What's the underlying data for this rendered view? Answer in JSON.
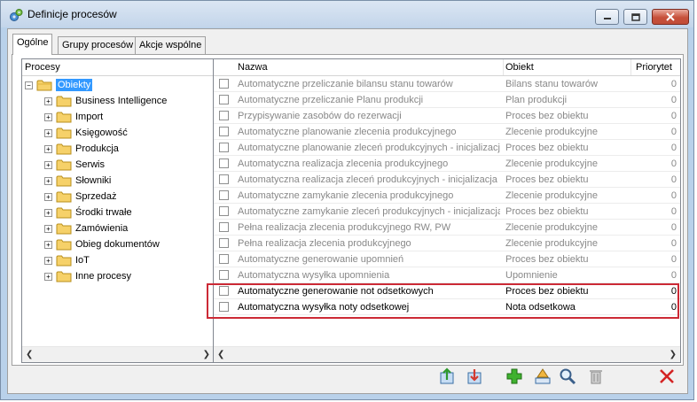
{
  "window": {
    "title": "Definicje procesów"
  },
  "tabs": [
    {
      "label": "Ogólne",
      "active": true
    },
    {
      "label": "Grupy procesów",
      "active": false
    },
    {
      "label": "Akcje wspólne",
      "active": false
    }
  ],
  "tree": {
    "header": "Procesy",
    "root": {
      "label": "Obiekty",
      "expander": "−"
    },
    "items": [
      {
        "label": "Business Intelligence",
        "expander": "+"
      },
      {
        "label": "Import",
        "expander": "+"
      },
      {
        "label": "Księgowość",
        "expander": "+"
      },
      {
        "label": "Produkcja",
        "expander": "+"
      },
      {
        "label": "Serwis",
        "expander": "+"
      },
      {
        "label": "Słowniki",
        "expander": "+"
      },
      {
        "label": "Sprzedaż",
        "expander": "+"
      },
      {
        "label": "Środki trwałe",
        "expander": "+"
      },
      {
        "label": "Zamówienia",
        "expander": "+"
      },
      {
        "label": "Obieg dokumentów",
        "expander": "+"
      },
      {
        "label": "IoT",
        "expander": "+"
      },
      {
        "label": "Inne procesy",
        "expander": "+"
      }
    ]
  },
  "grid": {
    "columns": {
      "name": "Nazwa",
      "object": "Obiekt",
      "priority": "Priorytet"
    },
    "rows": [
      {
        "name": "Automatyczne przeliczanie bilansu stanu towarów",
        "object": "Bilans stanu towarów",
        "priority": "0",
        "inactive": true
      },
      {
        "name": "Automatyczne przeliczanie Planu produkcji",
        "object": "Plan produkcji",
        "priority": "0",
        "inactive": true
      },
      {
        "name": "Przypisywanie zasobów do rezerwacji",
        "object": "Proces bez obiektu",
        "priority": "0",
        "inactive": true
      },
      {
        "name": "Automatyczne planowanie zlecenia produkcyjnego",
        "object": "Zlecenie produkcyjne",
        "priority": "0",
        "inactive": true
      },
      {
        "name": "Automatyczne planowanie zleceń produkcyjnych - inicjalizacja",
        "object": "Proces bez obiektu",
        "priority": "0",
        "inactive": true
      },
      {
        "name": "Automatyczna realizacja zlecenia produkcyjnego",
        "object": "Zlecenie produkcyjne",
        "priority": "0",
        "inactive": true
      },
      {
        "name": "Automatyczna realizacja zleceń produkcyjnych - inicjalizacja",
        "object": "Proces bez obiektu",
        "priority": "0",
        "inactive": true
      },
      {
        "name": "Automatyczne zamykanie zlecenia produkcyjnego",
        "object": "Zlecenie produkcyjne",
        "priority": "0",
        "inactive": true
      },
      {
        "name": "Automatyczne zamykanie zleceń produkcyjnych - inicjalizacja",
        "object": "Proces bez obiektu",
        "priority": "0",
        "inactive": true
      },
      {
        "name": "Pełna realizacja zlecenia produkcyjnego RW, PW",
        "object": "Zlecenie produkcyjne",
        "priority": "0",
        "inactive": true
      },
      {
        "name": "Pełna realizacja zlecenia produkcyjnego",
        "object": "Zlecenie produkcyjne",
        "priority": "0",
        "inactive": true
      },
      {
        "name": "Automatyczne generowanie upomnień",
        "object": "Proces bez obiektu",
        "priority": "0",
        "inactive": true
      },
      {
        "name": "Automatyczna wysyłka upomnienia",
        "object": "Upomnienie",
        "priority": "0",
        "inactive": true
      },
      {
        "name": "Automatyczne generowanie not odsetkowych",
        "object": "Proces bez obiektu",
        "priority": "0",
        "inactive": false
      },
      {
        "name": "Automatyczna wysyłka noty odsetkowej",
        "object": "Nota odsetkowa",
        "priority": "0",
        "inactive": false
      }
    ]
  },
  "toolbar": [
    {
      "name": "export-button",
      "icon": "export-icon"
    },
    {
      "name": "import-button",
      "icon": "import-icon"
    },
    {
      "name": "add-button",
      "icon": "add-icon"
    },
    {
      "name": "edit-button",
      "icon": "edit-icon"
    },
    {
      "name": "find-button",
      "icon": "search-icon"
    },
    {
      "name": "delete-button",
      "icon": "trash-icon"
    },
    {
      "name": "close-button",
      "icon": "close-icon"
    }
  ],
  "colors": {
    "selection": "#3399ff",
    "highlight_border": "#cc2a36",
    "inactive_text": "#888888"
  }
}
